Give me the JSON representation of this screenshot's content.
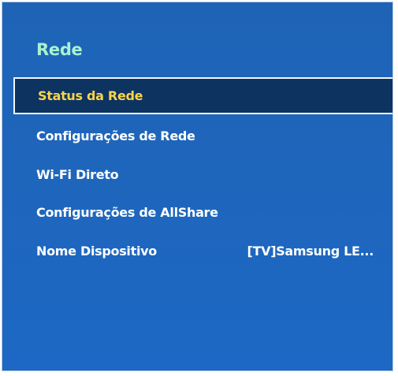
{
  "menu": {
    "title": "Rede",
    "items": [
      {
        "label": "Status da Rede",
        "value": "",
        "selected": true
      },
      {
        "label": "Configurações de Rede",
        "value": ""
      },
      {
        "label": "Wi-Fi Direto",
        "value": ""
      },
      {
        "label": "Configurações de AllShare",
        "value": ""
      },
      {
        "label": "Nome Dispositivo",
        "value": "[TV]Samsung LE..."
      }
    ]
  },
  "colors": {
    "panel_background": "#1e66bd",
    "highlight_background": "#0d3361",
    "highlight_text": "#f8d44b",
    "title_text": "#a9f2cf"
  }
}
